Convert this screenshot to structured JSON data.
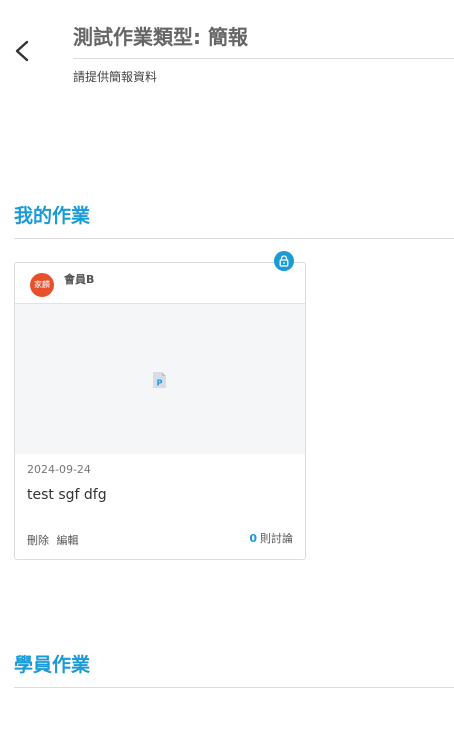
{
  "header": {
    "title": "測試作業類型: 簡報",
    "subtitle": "請提供簡報資料"
  },
  "sections": {
    "my_work": {
      "title": "我的作業"
    },
    "student_work": {
      "title": "學員作業"
    }
  },
  "card": {
    "avatar_text": "家麟",
    "member": "會員B",
    "date": "2024-09-24",
    "title": "test sgf dfg",
    "delete_label": "刪除",
    "edit_label": "編輯",
    "discussion_count": "0",
    "discussion_label": "則討論",
    "file_type": "ppt-file-icon"
  },
  "colors": {
    "accent": "#1a9ad6",
    "avatar_bg": "#e8502c",
    "thumb_bg": "#f5f6f8"
  }
}
